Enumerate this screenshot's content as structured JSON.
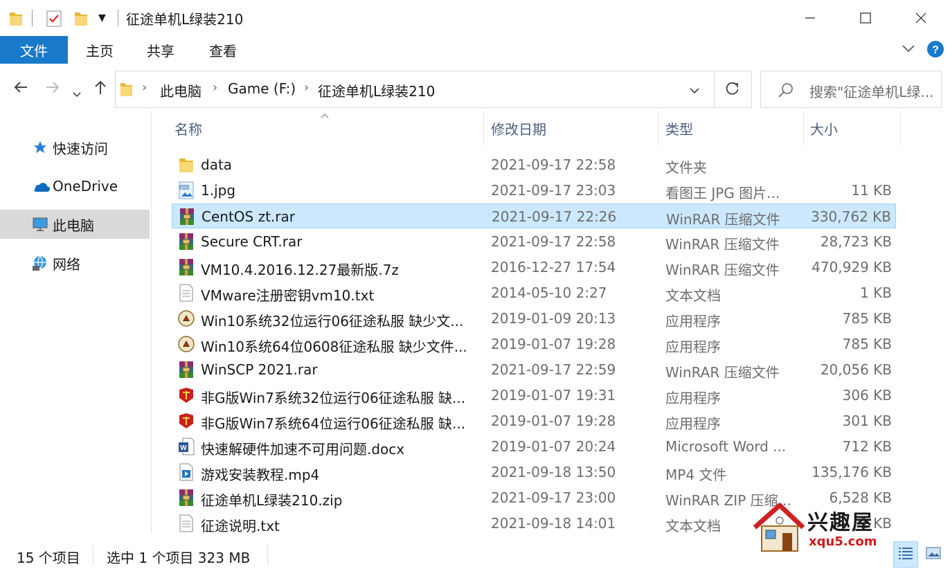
{
  "window": {
    "title": "征途单机L绿装210",
    "controls": {
      "minimize": "—",
      "maximize": "☐",
      "close": "✕"
    }
  },
  "ribbon": {
    "tabs": [
      {
        "label": "文件",
        "active": true
      },
      {
        "label": "主页"
      },
      {
        "label": "共享"
      },
      {
        "label": "查看"
      }
    ]
  },
  "address": {
    "crumbs": [
      "此电脑",
      "Game (F:)",
      "征途单机L绿装210"
    ],
    "search_placeholder": "搜索\"征途单机L绿..."
  },
  "sidebar": {
    "items": [
      {
        "label": "快速访问",
        "icon": "star-icon"
      },
      {
        "label": "OneDrive",
        "icon": "cloud-icon"
      },
      {
        "label": "此电脑",
        "icon": "computer-icon",
        "selected": true
      },
      {
        "label": "网络",
        "icon": "network-icon"
      }
    ]
  },
  "columns": {
    "name": "名称",
    "date": "修改日期",
    "type": "类型",
    "size": "大小"
  },
  "files": [
    {
      "name": "data",
      "date": "2021-09-17 22:58",
      "type": "文件夹",
      "size": "",
      "icon": "folder-icon"
    },
    {
      "name": "1.jpg",
      "date": "2021-09-17 23:03",
      "type": "看图王 JPG 图片...",
      "size": "11 KB",
      "icon": "jpg-file-icon"
    },
    {
      "name": "CentOS zt.rar",
      "date": "2021-09-17 22:26",
      "type": "WinRAR 压缩文件",
      "size": "330,762 KB",
      "icon": "winrar-icon",
      "selected": true
    },
    {
      "name": "Secure   CRT.rar",
      "date": "2021-09-17 22:58",
      "type": "WinRAR 压缩文件",
      "size": "28,723 KB",
      "icon": "winrar-icon"
    },
    {
      "name": "VM10.4.2016.12.27最新版.7z",
      "date": "2016-12-27 17:54",
      "type": "WinRAR 压缩文件",
      "size": "470,929 KB",
      "icon": "winrar-icon"
    },
    {
      "name": "VMware注册密钥vm10.txt",
      "date": "2014-05-10 2:27",
      "type": "文本文档",
      "size": "1 KB",
      "icon": "text-file-icon"
    },
    {
      "name": "Win10系统32位运行06征途私服 缺少文...",
      "date": "2019-01-09 20:13",
      "type": "应用程序",
      "size": "785 KB",
      "icon": "game-app-icon"
    },
    {
      "name": "Win10系统64位0608征途私服 缺少文件...",
      "date": "2019-01-07 19:28",
      "type": "应用程序",
      "size": "785 KB",
      "icon": "game-app-icon"
    },
    {
      "name": "WinSCP   2021.rar",
      "date": "2021-09-17 22:59",
      "type": "WinRAR 压缩文件",
      "size": "20,056 KB",
      "icon": "winrar-icon"
    },
    {
      "name": "非G版Win7系统32位运行06征途私服 缺...",
      "date": "2019-01-07 19:31",
      "type": "应用程序",
      "size": "306 KB",
      "icon": "red-app-icon"
    },
    {
      "name": "非G版Win7系统64位运行06征途私服 缺...",
      "date": "2019-01-07 19:28",
      "type": "应用程序",
      "size": "301 KB",
      "icon": "red-app-icon"
    },
    {
      "name": "快速解硬件加速不可用问题.docx",
      "date": "2019-01-07 20:24",
      "type": "Microsoft Word ...",
      "size": "712 KB",
      "icon": "word-file-icon"
    },
    {
      "name": "游戏安装教程.mp4",
      "date": "2021-09-18 13:50",
      "type": "MP4 文件",
      "size": "135,176 KB",
      "icon": "video-file-icon"
    },
    {
      "name": "征途单机L绿装210.zip",
      "date": "2021-09-17 23:00",
      "type": "WinRAR ZIP 压缩...",
      "size": "6,528 KB",
      "icon": "winrar-icon"
    },
    {
      "name": "征途说明.txt",
      "date": "2021-09-18 14:01",
      "type": "文本文档",
      "size": "1 KB",
      "icon": "text-file-icon"
    }
  ],
  "status": {
    "count": "15 个项目",
    "selection": "选中 1 个项目  323 MB"
  },
  "watermark": {
    "text": "兴趣屋",
    "url": "xqu5.com"
  },
  "colors": {
    "accent": "#1979ca",
    "selection": "#cce8ff",
    "selection_border": "#99d1ff",
    "header_text": "#4d6082"
  }
}
